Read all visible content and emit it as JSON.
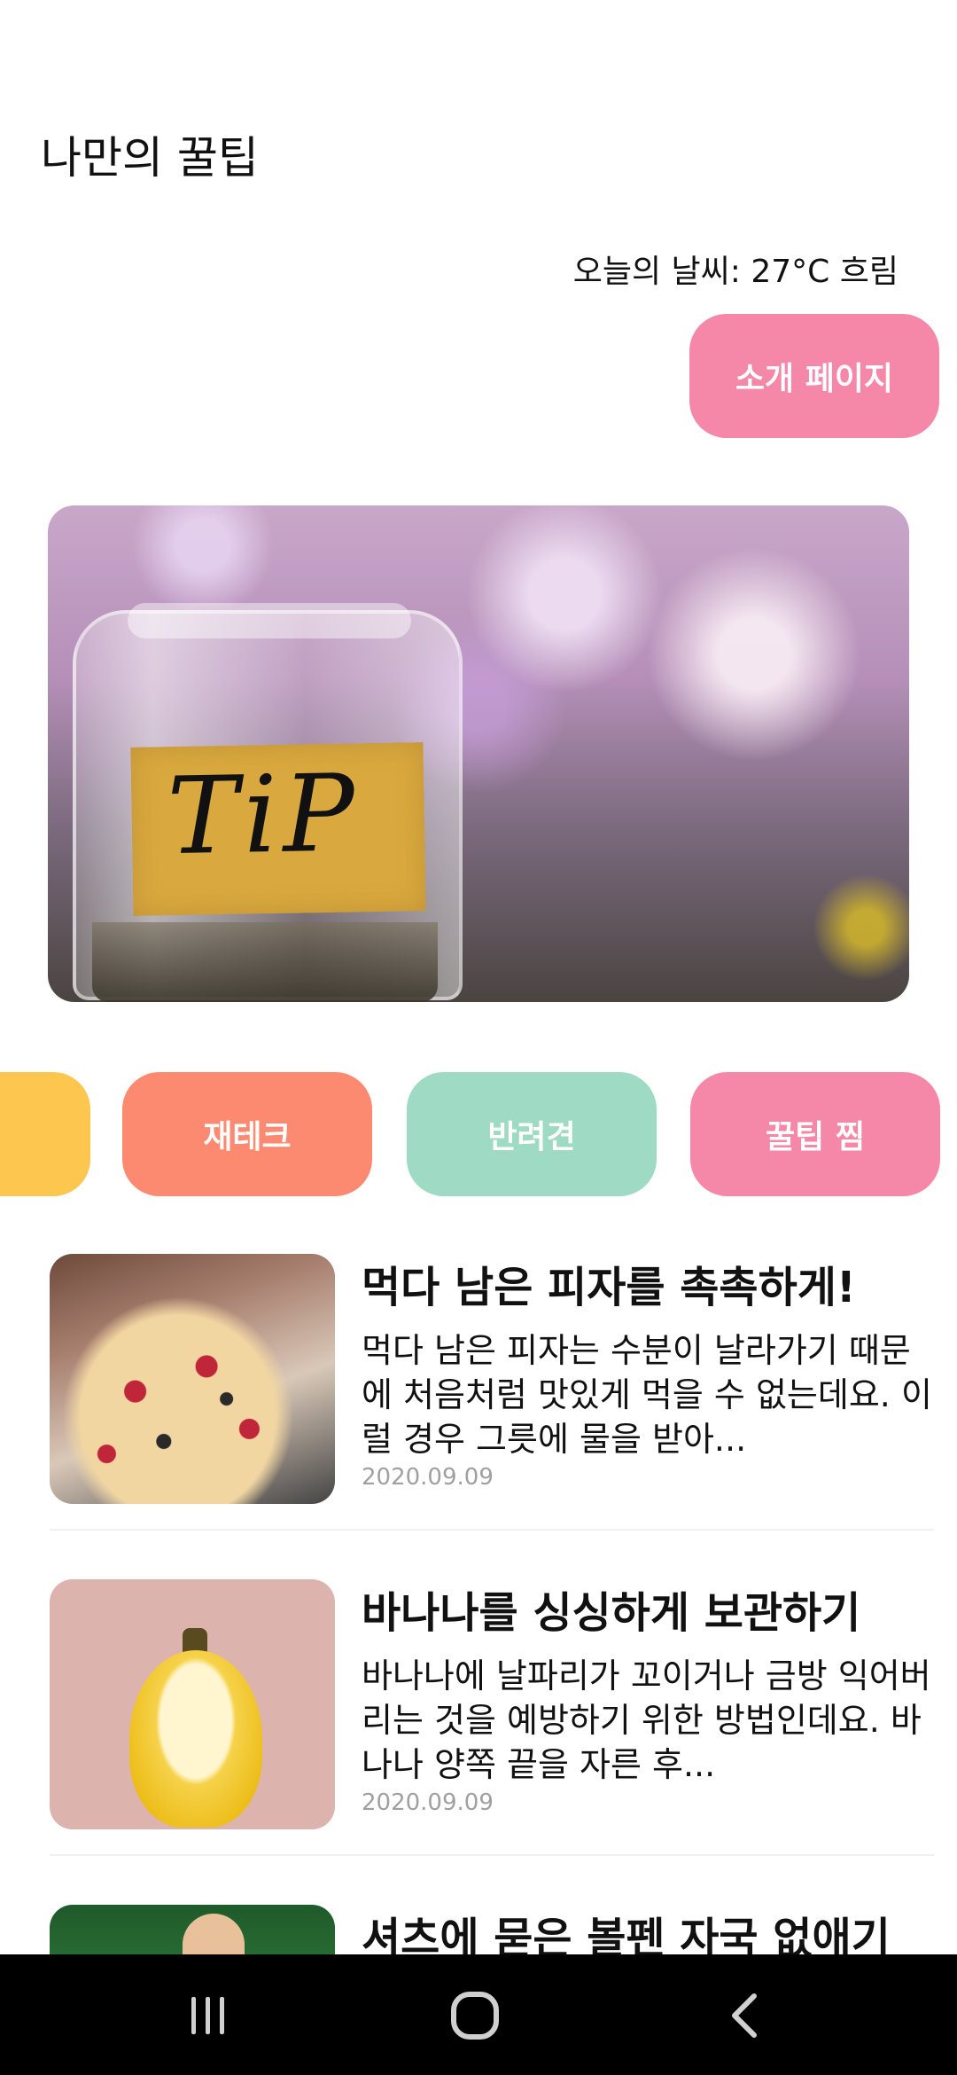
{
  "header": {
    "title": "나만의 꿀팁",
    "weather": "오늘의 날씨: 27°C 흐림",
    "about_button": "소개 페이지"
  },
  "hero": {
    "image_text": "TiP"
  },
  "categories": [
    {
      "label": ""
    },
    {
      "label": "재테크"
    },
    {
      "label": "반려견"
    },
    {
      "label": "꿀팁 찜"
    }
  ],
  "colors": {
    "pink": "#f587a9",
    "salmon": "#fb8a70",
    "mint": "#9edac4",
    "yellow": "#fdc74f"
  },
  "articles": [
    {
      "title": "먹다 남은 피자를 촉촉하게!",
      "desc": "먹다 남은 피자는 수분이 날라가기 때문에 처음처럼 맛있게 먹을 수 없는데요. 이럴 경우 그릇에 물을 받아...",
      "date": "2020.09.09"
    },
    {
      "title": "바나나를 싱싱하게 보관하기",
      "desc": "바나나에 날파리가 꼬이거나 금방 익어버리는 것을 예방하기 위한 방법인데요. 바나나 양쪽 끝을 자른 후...",
      "date": "2020.09.09"
    },
    {
      "title": "셔츠에 묻은 볼펜 자국 없애기"
    }
  ],
  "navbar": {
    "icons": [
      "recent-apps-icon",
      "home-icon",
      "back-icon"
    ]
  }
}
